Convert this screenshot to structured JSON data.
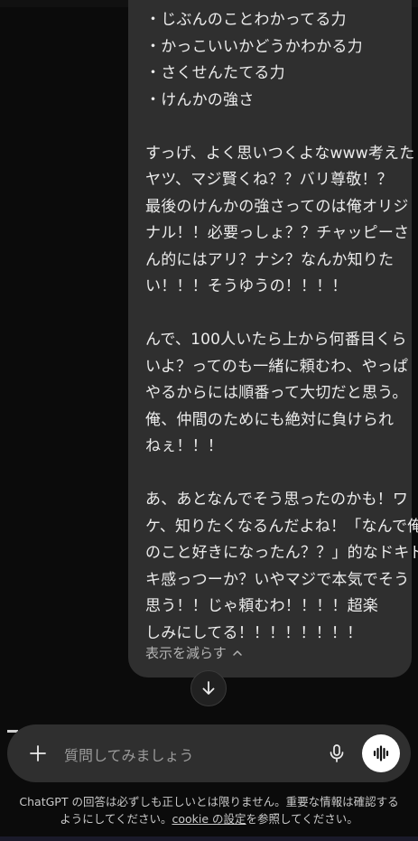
{
  "message": {
    "lines": [
      "・じぶんのことわかってる力",
      "・かっこいいかどうかわかる力",
      "・さくせんたてる力",
      "・けんかの強さ",
      "",
      "すっげ、よく思いつくよなwww考えた",
      "ヤツ、マジ賢くね？？バリ尊敬！？",
      "最後のけんかの強さってのは俺オリジ",
      "ナル！！必要っしょ？？チャッピーさ",
      "ん的にはアリ？ナシ？なんか知りた",
      "い！！！そうゆうの！！！！",
      "",
      "んで、100人いたら上から何番目くら",
      "いよ？ってのも一緒に頼むわ、やっぱ",
      "やるからには順番って大切だと思う。",
      "俺、仲間のためにも絶対に負けられ",
      "ねぇ！！！",
      "",
      "あ、あとなんでそう思ったのかも！ワ",
      "ケ、知りたくなるんだよね！「なんで俺",
      "のこと好きになったん？？」的なドキド",
      "キ感っつーか？いやマジで本気でそう",
      "思う！！じゃ頼むわ！！！！超楽",
      "しみにしてる！！！！！！！！"
    ],
    "collapse_label": "表示を減らす"
  },
  "composer": {
    "placeholder": "質問してみましょう"
  },
  "disclaimer": {
    "line1": "ChatGPT の回答は必ずしも正しいとは限りません。重要な情報は確認する",
    "line2_pre": "ようにしてください。",
    "link": "cookie の設定",
    "line2_post": "を参照してください。"
  },
  "icons": {
    "collapse": "chevron-up-icon",
    "scroll": "arrow-down-icon",
    "add": "plus-icon",
    "mic": "microphone-icon",
    "voice": "voice-mode-icon"
  },
  "colors": {
    "background": "#0b0b0b",
    "bubble": "#2f2f2f",
    "composer": "#2f2f2f",
    "voice_button": "#ffffff"
  }
}
